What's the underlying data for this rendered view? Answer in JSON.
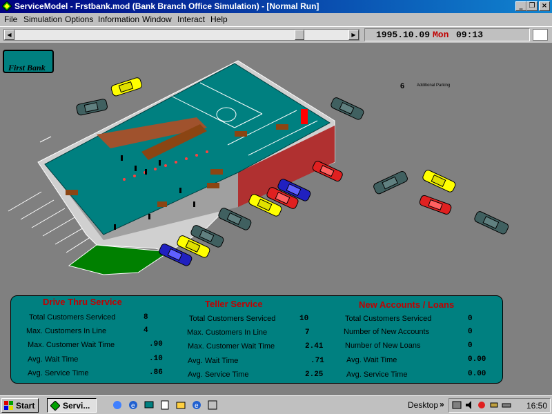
{
  "window": {
    "title": "ServiceModel - Frstbank.mod (Bank Branch Office Simulation) - [Normal Run]",
    "controls": [
      "minimize",
      "restore",
      "close"
    ]
  },
  "menu": [
    "File",
    "Simulation",
    "Options",
    "Information",
    "Window",
    "Interact",
    "Help"
  ],
  "clock": {
    "date": "1995.10.09",
    "day": "Mon",
    "time": "09:13"
  },
  "logo": {
    "text": "First Bank"
  },
  "parking": {
    "count": "6",
    "label": "Additional Parking"
  },
  "stats": {
    "drive_thru": {
      "title": "Drive Thru Service",
      "rows": [
        {
          "label": "Total Customers Serviced",
          "value": "8"
        },
        {
          "label": "Max. Customers In Line",
          "value": "4"
        },
        {
          "label": "Max. Customer Wait Time",
          "value": ".90"
        },
        {
          "label": "Avg. Wait Time",
          "value": ".10"
        },
        {
          "label": "Avg. Service Time",
          "value": ".86"
        }
      ]
    },
    "teller": {
      "title": "Teller Service",
      "rows": [
        {
          "label": "Total Customers Serviced",
          "value": "10"
        },
        {
          "label": "Max. Customers In Line",
          "value": "7"
        },
        {
          "label": "Max. Customer Wait Time",
          "value": "2.41"
        },
        {
          "label": "Avg. Wait Time",
          "value": ".71"
        },
        {
          "label": "Avg. Service Time",
          "value": "2.25"
        }
      ]
    },
    "new_accounts": {
      "title": "New Accounts / Loans",
      "rows": [
        {
          "label": "Total Customers Serviced",
          "value": "0"
        },
        {
          "label": "Number of New Accounts",
          "value": "0"
        },
        {
          "label": "Number of New Loans",
          "value": "0"
        },
        {
          "label": "Avg. Wait Time",
          "value": "0.00"
        },
        {
          "label": "Avg. Service Time",
          "value": "0.00"
        }
      ]
    }
  },
  "taskbar": {
    "start_label": "Start",
    "task_label": "Servi...",
    "desktop_label": "Desktop",
    "chevron": "»",
    "time": "16:50",
    "quicklaunch_icons": [
      "browser-icon",
      "ie-icon",
      "desktop-icon",
      "notepad-icon",
      "explorer-icon",
      "ie-icon",
      "app-icon"
    ],
    "tray_icons": [
      "network-icon",
      "volume-icon",
      "agent-icon",
      "tool-icon",
      "scanner-icon"
    ]
  },
  "colors": {
    "floor": "#008080",
    "panel": "#008080",
    "section_title": "#c00000",
    "clock_day": "#c00000",
    "lawn": "#008000"
  }
}
